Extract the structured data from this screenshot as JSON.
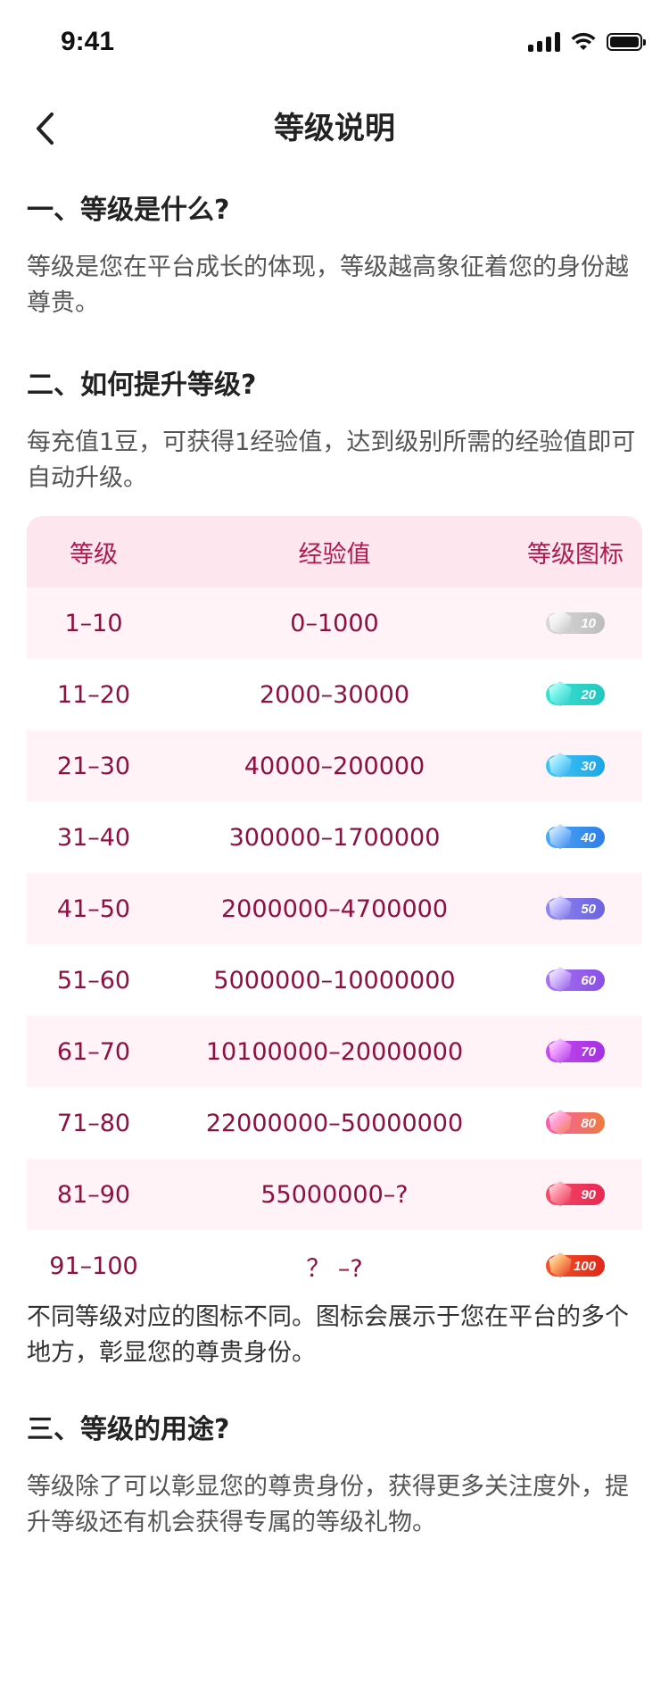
{
  "status_bar": {
    "time": "9:41",
    "icons": [
      "cellular-signal-icon",
      "wifi-icon",
      "battery-icon"
    ]
  },
  "nav": {
    "title": "等级说明",
    "back_icon": "chevron-left-icon"
  },
  "sections": {
    "s1": {
      "title": "一、等级是什么?",
      "text": "等级是您在平台成长的体现，等级越高象征着您的身份越尊贵。"
    },
    "s2": {
      "title": "二、如何提升等级?",
      "text": "每充值1豆，可获得1经验值，达到级别所需的经验值即可自动升级。"
    },
    "note": {
      "text": "不同等级对应的图标不同。图标会展示于您在平台的多个地方，彰显您的尊贵身份。"
    },
    "s3": {
      "title": "三、等级的用途?",
      "text": "等级除了可以彰显您的尊贵身份，获得更多关注度外，提升等级还有机会获得专属的等级礼物。"
    }
  },
  "table": {
    "headers": [
      "等级",
      "经验值",
      "等级图标"
    ],
    "rows": [
      {
        "level": "1–10",
        "exp": "0–1000",
        "badge": "10",
        "color_a": "#d9d9d9",
        "color_b": "#bdbdbd",
        "gem": "#f2f2f2"
      },
      {
        "level": "11–20",
        "exp": "2000–30000",
        "badge": "20",
        "color_a": "#3ee0d0",
        "color_b": "#21c7c0",
        "gem": "#7af5ec"
      },
      {
        "level": "21–30",
        "exp": "40000–200000",
        "badge": "30",
        "color_a": "#3fc6f5",
        "color_b": "#1ea5e8",
        "gem": "#8fe3ff"
      },
      {
        "level": "31–40",
        "exp": "300000–1700000",
        "badge": "40",
        "color_a": "#4aa8f5",
        "color_b": "#2f7ee8",
        "gem": "#9fd0ff"
      },
      {
        "level": "41–50",
        "exp": "2000000–4700000",
        "badge": "50",
        "color_a": "#8e86f0",
        "color_b": "#6c63e0",
        "gem": "#c4bfff"
      },
      {
        "level": "51–60",
        "exp": "5000000–10000000",
        "badge": "60",
        "color_a": "#a673f0",
        "color_b": "#8a4fe6",
        "gem": "#d7bfff"
      },
      {
        "level": "61–70",
        "exp": "10100000–20000000",
        "badge": "70",
        "color_a": "#c64cf0",
        "color_b": "#a52fe2",
        "gem": "#ee9cff"
      },
      {
        "level": "71–80",
        "exp": "22000000–50000000",
        "badge": "80",
        "color_a": "#f55fb0",
        "color_b": "#f07a3e",
        "gem": "#ff9fd6"
      },
      {
        "level": "81–90",
        "exp": "55000000–?",
        "badge": "90",
        "color_a": "#f54a6a",
        "color_b": "#e82850",
        "gem": "#ff98aa"
      },
      {
        "level": "91–100",
        "exp": "？ –?",
        "badge": "100",
        "color_a": "#f5512a",
        "color_b": "#e0281a",
        "gem": "#ffb06a"
      }
    ]
  },
  "colors": {
    "accent": "#b01a4f",
    "row_text": "#8e1040",
    "header_bg": "#fde6ee",
    "row_alt_bg": "#fff3f7"
  }
}
